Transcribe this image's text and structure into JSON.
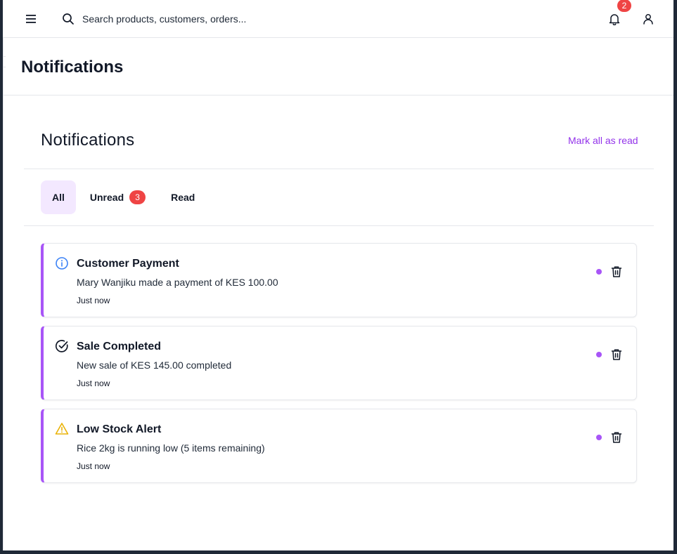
{
  "topbar": {
    "search_placeholder": "Search products, customers, orders...",
    "notification_count": "2",
    "icons": {
      "menu": "menu-icon",
      "search": "search-icon",
      "bell": "bell-icon",
      "user": "user-icon"
    }
  },
  "page": {
    "title": "Notifications"
  },
  "panel": {
    "title": "Notifications",
    "mark_all_label": "Mark all as read",
    "accent_color": "#a855f7",
    "tabs": [
      {
        "label": "All",
        "active": true
      },
      {
        "label": "Unread",
        "count": "3",
        "active": false
      },
      {
        "label": "Read",
        "active": false
      }
    ]
  },
  "notifications": [
    {
      "type": "info",
      "icon": "info-icon",
      "icon_color": "#3b82f6",
      "title": "Customer Payment",
      "message": "Mary Wanjiku made a payment of KES 100.00",
      "time": "Just now",
      "unread": true
    },
    {
      "type": "success",
      "icon": "check-circle-icon",
      "icon_color": "#111827",
      "title": "Sale Completed",
      "message": "New sale of KES 145.00 completed",
      "time": "Just now",
      "unread": true
    },
    {
      "type": "warning",
      "icon": "warning-icon",
      "icon_color": "#eab308",
      "title": "Low Stock Alert",
      "message": "Rice 2kg is running low (5 items remaining)",
      "time": "Just now",
      "unread": true
    }
  ]
}
